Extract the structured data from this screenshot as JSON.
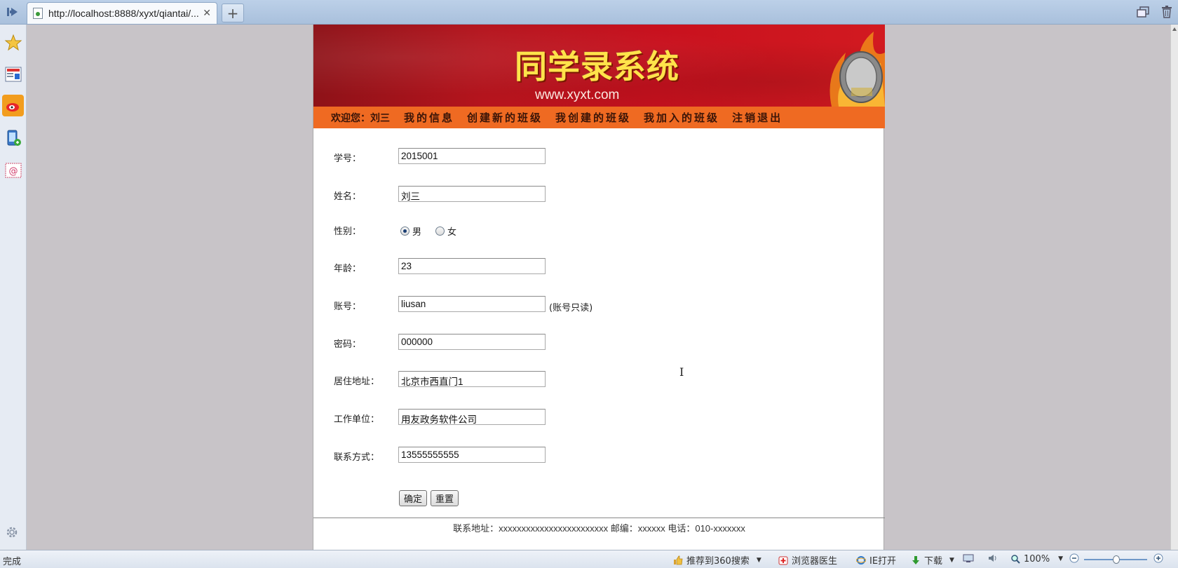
{
  "browser": {
    "tab_title": "http://localhost:8888/xyxt/qiantai/...",
    "status": "完成",
    "statusbar": {
      "recommend": "推荐到360搜索",
      "doctor": "浏览器医生",
      "ie_open": "IE打开",
      "download": "下载",
      "zoom": "100%"
    }
  },
  "banner": {
    "title": "同学录系统",
    "url": "www.xyxt.com"
  },
  "nav": {
    "welcome": "欢迎您：刘三",
    "items": [
      "我的信息",
      "创建新的班级",
      "我创建的班级",
      "我加入的班级",
      "注销退出"
    ]
  },
  "form": {
    "student_id_label": "学号：",
    "student_id": "2015001",
    "name_label": "姓名：",
    "name": "刘三",
    "gender_label": "性别：",
    "gender_options": [
      "男",
      "女"
    ],
    "gender_selected": "男",
    "age_label": "年龄：",
    "age": "23",
    "account_label": "账号：",
    "account": "liusan",
    "account_note": "(账号只读)",
    "password_label": "密码：",
    "password": "000000",
    "address_label": "居住地址：",
    "address": "北京市西直门1",
    "company_label": "工作单位：",
    "company": "用友政务软件公司",
    "contact_label": "联系方式：",
    "contact": "13555555555",
    "submit_label": "确定",
    "reset_label": "重置"
  },
  "footer": {
    "text": "联系地址：xxxxxxxxxxxxxxxxxxxxxxxx   邮编：xxxxxx 电话：010-xxxxxxx"
  },
  "colors": {
    "banner_red": "#c8111e",
    "nav_orange": "#ef6a22",
    "title_yellow": "#ffe34a"
  }
}
